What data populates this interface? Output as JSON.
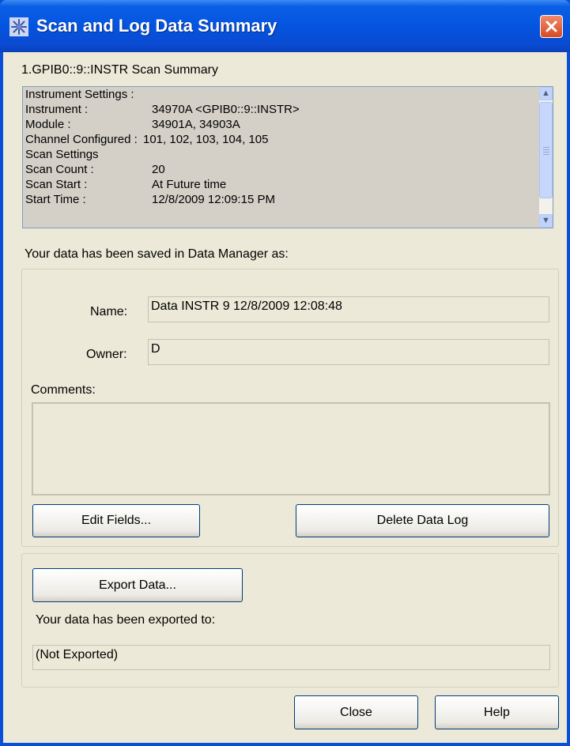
{
  "window": {
    "title": "Scan and Log Data Summary",
    "icon": "agilent-spark-icon",
    "close_icon": "close-icon"
  },
  "summary": {
    "heading": "1.GPIB0::9::INSTR Scan Summary",
    "rows": [
      {
        "label": "Instrument Settings :",
        "value": ""
      },
      {
        "label": "Instrument :",
        "value": "34970A <GPIB0::9::INSTR>"
      },
      {
        "label": "Module :",
        "value": "34901A, 34903A"
      },
      {
        "label": "Channel Configured :",
        "value": "101, 102, 103, 104, 105"
      },
      {
        "label": "Scan Settings",
        "value": ""
      },
      {
        "label": "Scan Count :",
        "value": "20"
      },
      {
        "label": "Scan Start :",
        "value": "At Future time"
      },
      {
        "label": "Start Time :",
        "value": "12/8/2009 12:09:15 PM"
      }
    ]
  },
  "data_manager": {
    "saved_text": "Your data has been saved in Data Manager as:",
    "name_label": "Name:",
    "name_value": "Data INSTR 9 12/8/2009 12:08:48",
    "owner_label": "Owner:",
    "owner_value": "D",
    "comments_label": "Comments:",
    "comments_value": "",
    "edit_fields_button": "Edit Fields...",
    "delete_log_button": "Delete Data Log"
  },
  "export": {
    "export_button": "Export Data...",
    "exported_text": "Your data has been exported to:",
    "exported_value": "(Not Exported)"
  },
  "footer": {
    "close_button": "Close",
    "help_button": "Help"
  },
  "colors": {
    "titlebar": "#0454e0",
    "dialog_face": "#ece9d8",
    "summary_background": "#d4d0c8",
    "close_button": "#d94a22"
  }
}
